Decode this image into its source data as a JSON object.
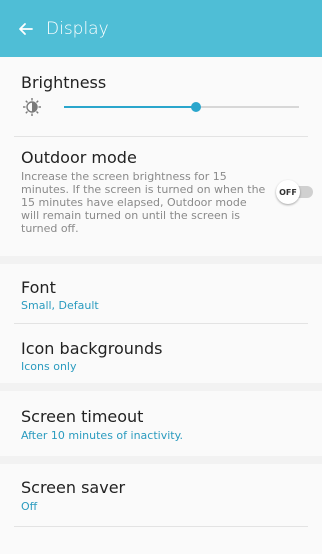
{
  "header": {
    "title": "Display",
    "background": "#4fbed6",
    "back_icon": "arrow-left-icon"
  },
  "brightness": {
    "title": "Brightness",
    "icon": "brightness-auto-icon",
    "level": 0.56
  },
  "outdoor_mode": {
    "title": "Outdoor mode",
    "description": "Increase the screen brightness for 15 minutes. If the screen is turned on when the 15 minutes have elapsed, Outdoor mode will remain turned on until the screen is turned off.",
    "toggle_label": "OFF",
    "enabled": false
  },
  "font": {
    "title": "Font",
    "value": "Small, Default"
  },
  "icon_backgrounds": {
    "title": "Icon backgrounds",
    "value": "Icons only"
  },
  "screen_timeout": {
    "title": "Screen timeout",
    "value": "After 10 minutes of inactivity."
  },
  "screen_saver": {
    "title": "Screen saver",
    "value": "Off"
  },
  "colors": {
    "accent": "#2aa6cc",
    "header": "#4fbed6",
    "text_primary": "#222222",
    "text_secondary": "#8a8a8a"
  }
}
